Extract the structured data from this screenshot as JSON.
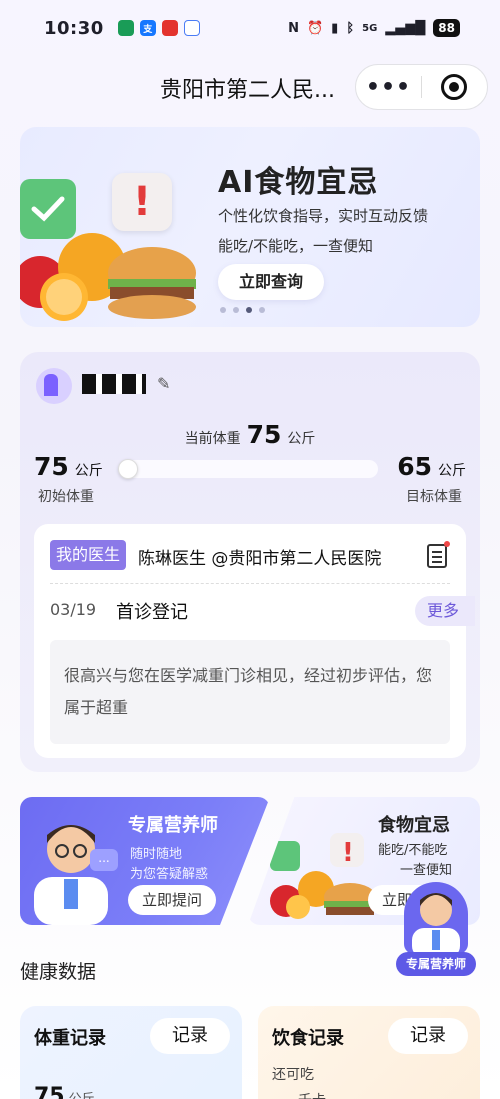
{
  "status": {
    "time": "10:30",
    "battery": "88",
    "signal": "5G"
  },
  "nav": {
    "title": "贵阳市第二人民...",
    "more": "•••"
  },
  "banner": {
    "title": "AI食物宜忌",
    "subtitle1": "个性化饮食指导，实时互动反馈",
    "subtitle2": "能吃/不能吃，一查便知",
    "button": "立即查询",
    "warn": "!"
  },
  "profile": {
    "current_label": "当前体重",
    "current_value": "75",
    "unit": "公斤",
    "initial_value": "75",
    "initial_label": "初始体重",
    "goal_value": "65",
    "goal_label": "目标体重",
    "progress": 0
  },
  "doctor": {
    "tag": "我的医生",
    "name": "陈琳医生 @贵阳市第二人民医院",
    "visit_date": "03/19",
    "visit_title": "首诊登记",
    "more": "更多",
    "note": "很高兴与您在医学减重门诊相见，经过初步评估，您属于超重"
  },
  "promo_nutritionist": {
    "title": "专属营养师",
    "sub1": "随时随地",
    "sub2": "为您答疑解惑",
    "button": "立即提问",
    "chat": "..."
  },
  "promo_food": {
    "title": "食物宜忌",
    "sub1": "能吃/不能吃",
    "sub2": "一查便知",
    "button": "立即"
  },
  "float_badge": "专属营养师",
  "section": {
    "title": "健康数据"
  },
  "stats": {
    "weight_title": "体重记录",
    "weight_button": "记录",
    "weight_value": "75",
    "weight_unit": "公斤",
    "diet_title": "饮食记录",
    "diet_button": "记录",
    "diet_sub": "还可吃",
    "diet_unit": "千卡"
  },
  "colors": {
    "accent": "#7b61ff",
    "doctor_tag": "#8b79e8",
    "promo": "#6d6cf2"
  }
}
